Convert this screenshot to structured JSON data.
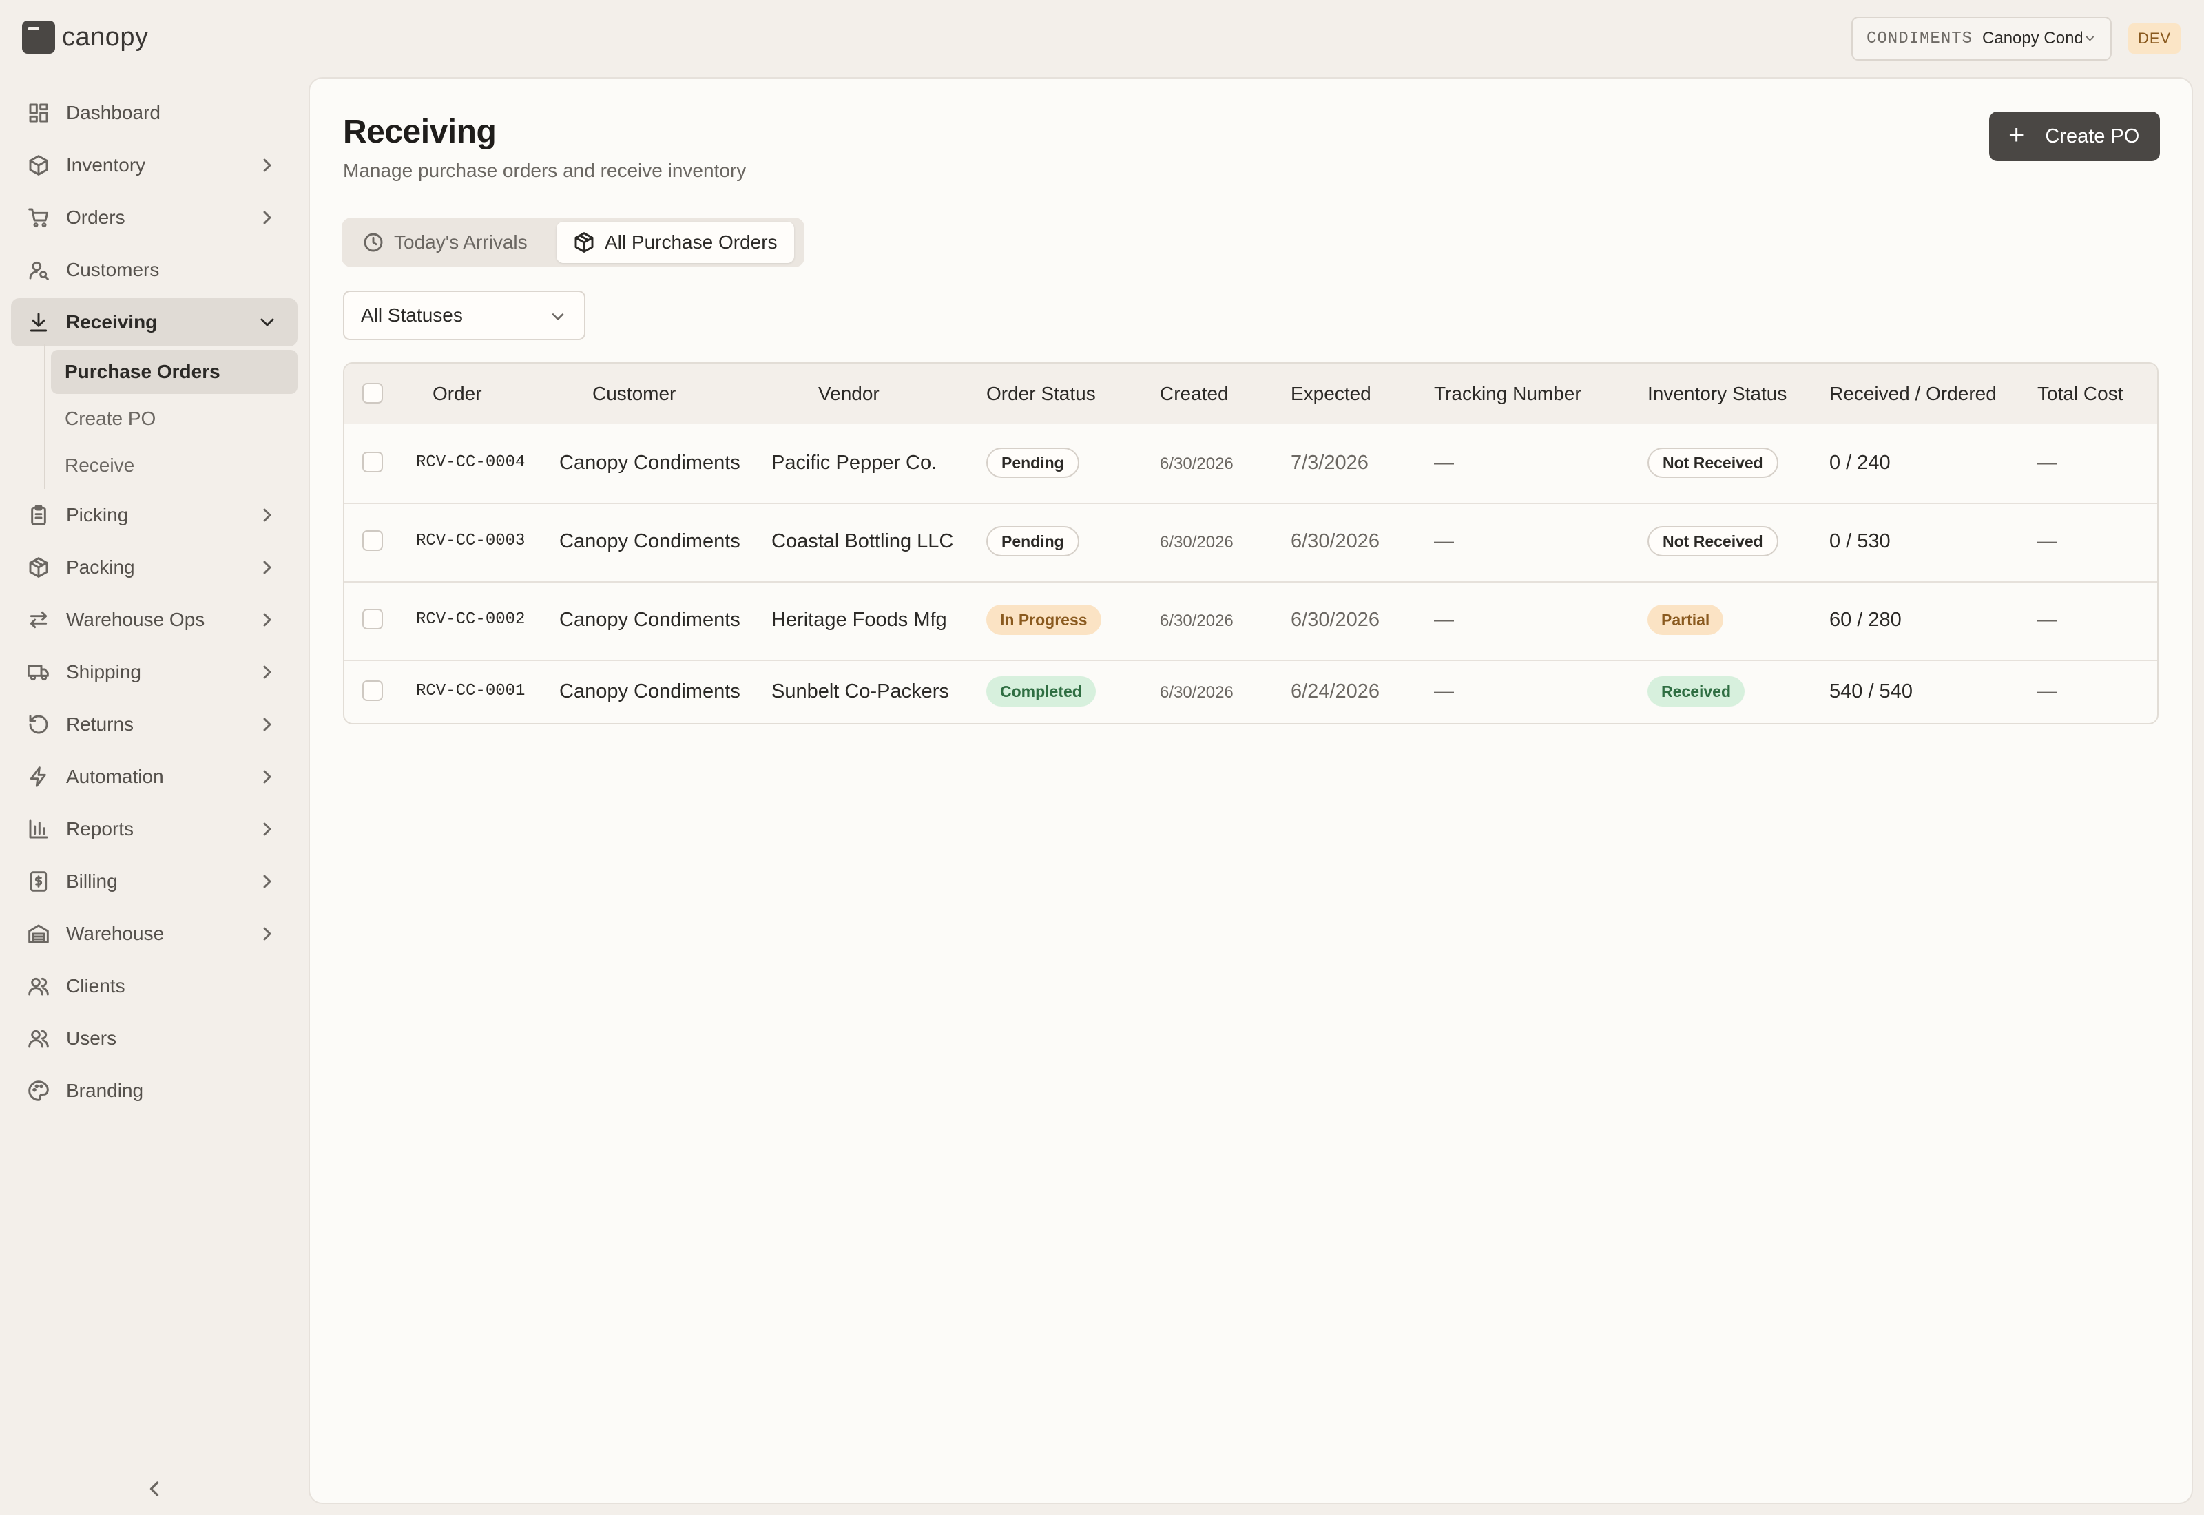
{
  "brand": {
    "name": "canopy"
  },
  "org_switcher": {
    "code": "CONDIMENTS",
    "name": "Canopy Condiments"
  },
  "env_badge": "DEV",
  "sidebar": {
    "items": [
      {
        "label": "Dashboard",
        "icon": "dashboard-icon"
      },
      {
        "label": "Inventory",
        "icon": "box-icon"
      },
      {
        "label": "Orders",
        "icon": "cart-icon"
      },
      {
        "label": "Customers",
        "icon": "customer-icon"
      },
      {
        "label": "Receiving",
        "icon": "download-icon",
        "active": true
      },
      {
        "label": "Picking",
        "icon": "clipboard-icon"
      },
      {
        "label": "Packing",
        "icon": "package-icon"
      },
      {
        "label": "Warehouse Ops",
        "icon": "arrows-icon"
      },
      {
        "label": "Shipping",
        "icon": "truck-icon"
      },
      {
        "label": "Returns",
        "icon": "return-icon"
      },
      {
        "label": "Automation",
        "icon": "lightning-icon"
      },
      {
        "label": "Reports",
        "icon": "bar-chart-icon"
      },
      {
        "label": "Billing",
        "icon": "billing-icon"
      },
      {
        "label": "Warehouse",
        "icon": "warehouse-icon"
      },
      {
        "label": "Clients",
        "icon": "clients-icon"
      },
      {
        "label": "Users",
        "icon": "users-icon"
      },
      {
        "label": "Branding",
        "icon": "palette-icon"
      }
    ],
    "receiving_sub": [
      "Purchase Orders",
      "Create PO",
      "Receive"
    ]
  },
  "page": {
    "title": "Receiving",
    "subtitle": "Manage purchase orders and receive inventory",
    "create_button": "Create PO",
    "tabs": [
      "Today's Arrivals",
      "All Purchase Orders"
    ],
    "active_tab": "All Purchase Orders",
    "status_filter": "All Statuses"
  },
  "table": {
    "columns": [
      "Order",
      "Customer",
      "Vendor",
      "Order Status",
      "Created",
      "Expected",
      "Tracking Number",
      "Inventory Status",
      "Received / Ordered",
      "Total Cost"
    ],
    "rows": [
      {
        "order": "RCV-CC-0004",
        "customer": "Canopy Condiments",
        "vendor": "Pacific Pepper Co.",
        "order_status": "Pending",
        "created": "6/30/2026",
        "expected": "7/3/2026",
        "tracking": "—",
        "inventory_status": "Not Received",
        "received_ordered": "0 / 240",
        "total_cost": "—"
      },
      {
        "order": "RCV-CC-0003",
        "customer": "Canopy Condiments",
        "vendor": "Coastal Bottling LLC",
        "order_status": "Pending",
        "created": "6/30/2026",
        "expected": "6/30/2026",
        "tracking": "—",
        "inventory_status": "Not Received",
        "received_ordered": "0 / 530",
        "total_cost": "—"
      },
      {
        "order": "RCV-CC-0002",
        "customer": "Canopy Condiments",
        "vendor": "Heritage Foods Mfg",
        "order_status": "In Progress",
        "created": "6/30/2026",
        "expected": "6/30/2026",
        "tracking": "—",
        "inventory_status": "Partial",
        "received_ordered": "60 / 280",
        "total_cost": "—"
      },
      {
        "order": "RCV-CC-0001",
        "customer": "Canopy Condiments",
        "vendor": "Sunbelt Co-Packers",
        "order_status": "Completed",
        "created": "6/30/2026",
        "expected": "6/24/2026",
        "tracking": "—",
        "inventory_status": "Received",
        "received_ordered": "540 / 540",
        "total_cost": "—"
      }
    ]
  },
  "colors": {
    "background": "#f3efea",
    "primary_button": "#4a4744",
    "pending_badge": "#fffdfa",
    "progress_badge": "#fbe3c4",
    "completed_badge": "#d7f0dd"
  }
}
